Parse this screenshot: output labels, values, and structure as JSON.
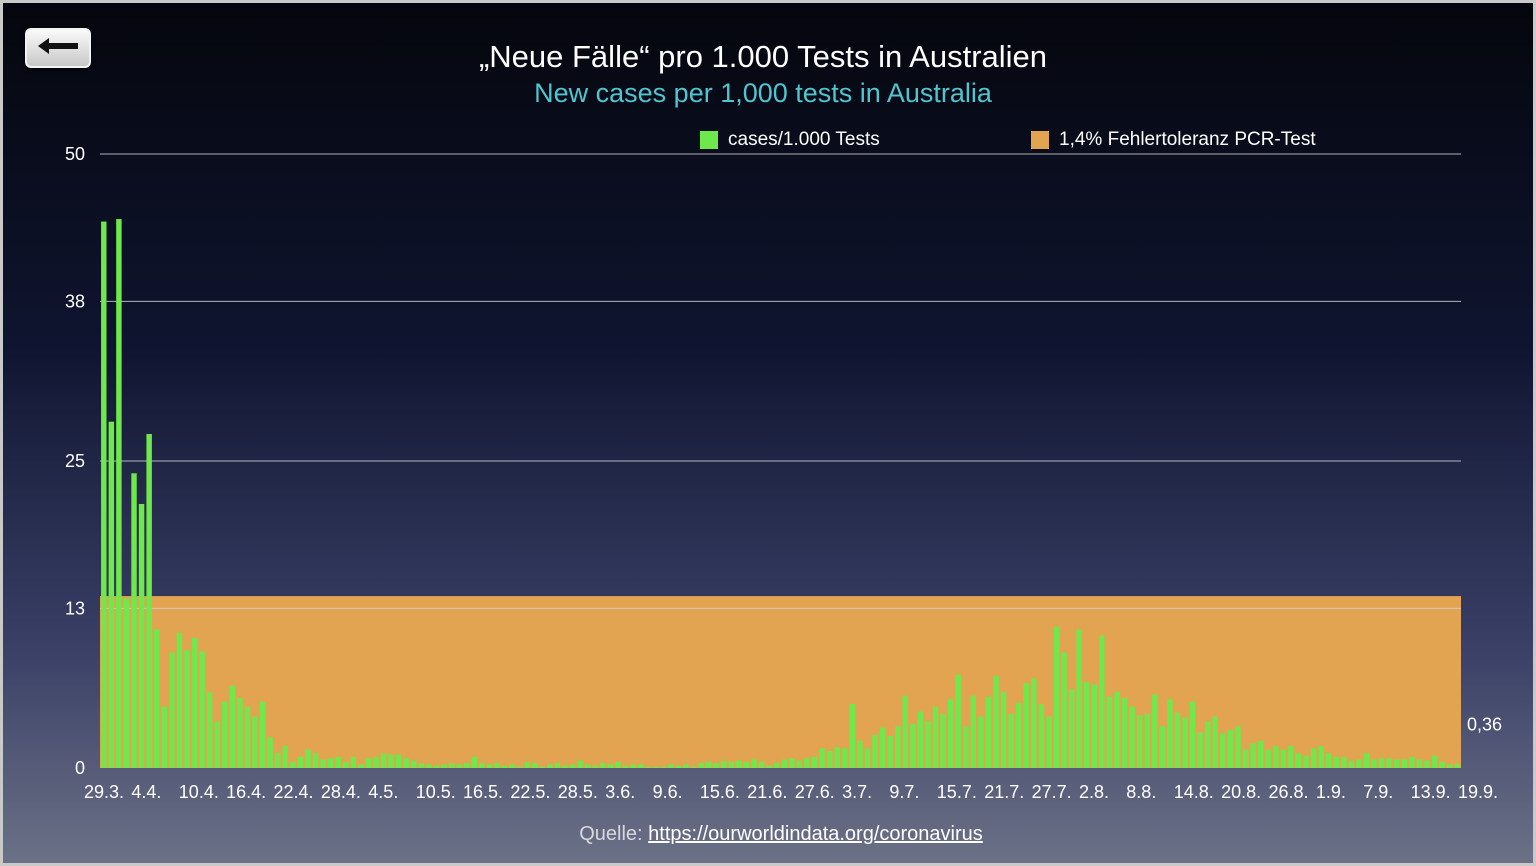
{
  "title": "„Neue Fälle“ pro 1.000 Tests in Australien",
  "subtitle": "New cases per 1,000 tests in Australia",
  "source_prefix": "Quelle:",
  "source_link": "https://ourworldindata.org/coronavirus",
  "back_button_icon": "left-arrow-icon",
  "colors": {
    "bars": "#6ee84a",
    "band": "#e3a452",
    "gridline": "#cfcfcf",
    "subtitle": "#4fc6cf"
  },
  "chart_data": {
    "type": "bar",
    "title": "„Neue Fälle“ pro 1.000 Tests in Australien",
    "subtitle": "New cases per 1,000 tests in Australia",
    "ylim": [
      0,
      50
    ],
    "yticks": [
      0,
      13,
      25,
      38,
      50
    ],
    "grid": true,
    "legend_position": "top",
    "legend": [
      {
        "label": "cases/1.000 Tests",
        "color": "#6ee84a"
      },
      {
        "label": "1,4% Fehlertoleranz PCR-Test",
        "color": "#e3a452"
      }
    ],
    "band": {
      "name": "1,4% Fehlertoleranz PCR-Test",
      "from": 0,
      "to": 14
    },
    "end_label": "0,36",
    "x_tick_labels": [
      "29.3.",
      "4.4.",
      "10.4.",
      "16.4.",
      "22.4.",
      "28.4.",
      "4.5.",
      "10.5.",
      "16.5.",
      "22.5.",
      "28.5.",
      "3.6.",
      "9.6.",
      "15.6.",
      "21.6.",
      "27.6.",
      "3.7.",
      "9.7.",
      "15.7.",
      "21.7.",
      "27.7.",
      "2.8.",
      "8.8.",
      "14.8.",
      "20.8.",
      "26.8.",
      "1.9.",
      "7.9.",
      "13.9.",
      "19.9."
    ],
    "series": [
      {
        "name": "cases/1.000 Tests",
        "values": [
          44.5,
          28.2,
          44.7,
          13.8,
          24.0,
          21.5,
          27.2,
          11.3,
          5.0,
          9.4,
          11.0,
          9.6,
          10.6,
          9.5,
          6.2,
          3.8,
          5.4,
          6.7,
          5.7,
          5.0,
          4.2,
          5.4,
          2.5,
          1.2,
          1.8,
          0.5,
          0.9,
          1.5,
          1.2,
          0.7,
          0.8,
          0.9,
          0.5,
          0.9,
          0.3,
          0.8,
          0.9,
          1.2,
          1.1,
          1.1,
          0.8,
          0.6,
          0.4,
          0.3,
          0.2,
          0.3,
          0.4,
          0.3,
          0.4,
          0.9,
          0.4,
          0.3,
          0.4,
          0.2,
          0.3,
          0.1,
          0.5,
          0.4,
          0.1,
          0.3,
          0.4,
          0.2,
          0.3,
          0.6,
          0.3,
          0.2,
          0.4,
          0.3,
          0.5,
          0.2,
          0.3,
          0.3,
          0.1,
          0.1,
          0.1,
          0.3,
          0.2,
          0.3,
          0.1,
          0.4,
          0.5,
          0.4,
          0.6,
          0.5,
          0.6,
          0.5,
          0.7,
          0.5,
          0.2,
          0.4,
          0.7,
          0.8,
          0.6,
          0.8,
          0.9,
          1.6,
          1.4,
          1.7,
          1.6,
          5.2,
          2.2,
          1.6,
          2.7,
          3.3,
          2.6,
          3.4,
          5.9,
          3.6,
          4.6,
          3.8,
          5.0,
          4.4,
          5.6,
          7.6,
          3.4,
          5.9,
          4.2,
          5.8,
          7.5,
          6.2,
          4.4,
          5.3,
          6.9,
          7.3,
          5.2,
          4.2,
          11.5,
          9.4,
          6.4,
          11.3,
          7.0,
          6.8,
          10.8,
          5.8,
          6.2,
          5.7,
          5.0,
          4.3,
          4.4,
          6.0,
          3.4,
          5.6,
          4.5,
          4.1,
          5.4,
          2.9,
          3.8,
          4.2,
          2.8,
          3.1,
          3.4,
          1.5,
          2.0,
          2.2,
          1.5,
          1.8,
          1.5,
          1.8,
          1.2,
          1.0,
          1.6,
          1.8,
          1.2,
          0.9,
          0.9,
          0.6,
          0.7,
          1.2,
          0.7,
          0.8,
          0.8,
          0.7,
          0.7,
          0.9,
          0.7,
          0.6,
          1.0,
          0.5,
          0.3,
          0.36
        ]
      }
    ]
  }
}
